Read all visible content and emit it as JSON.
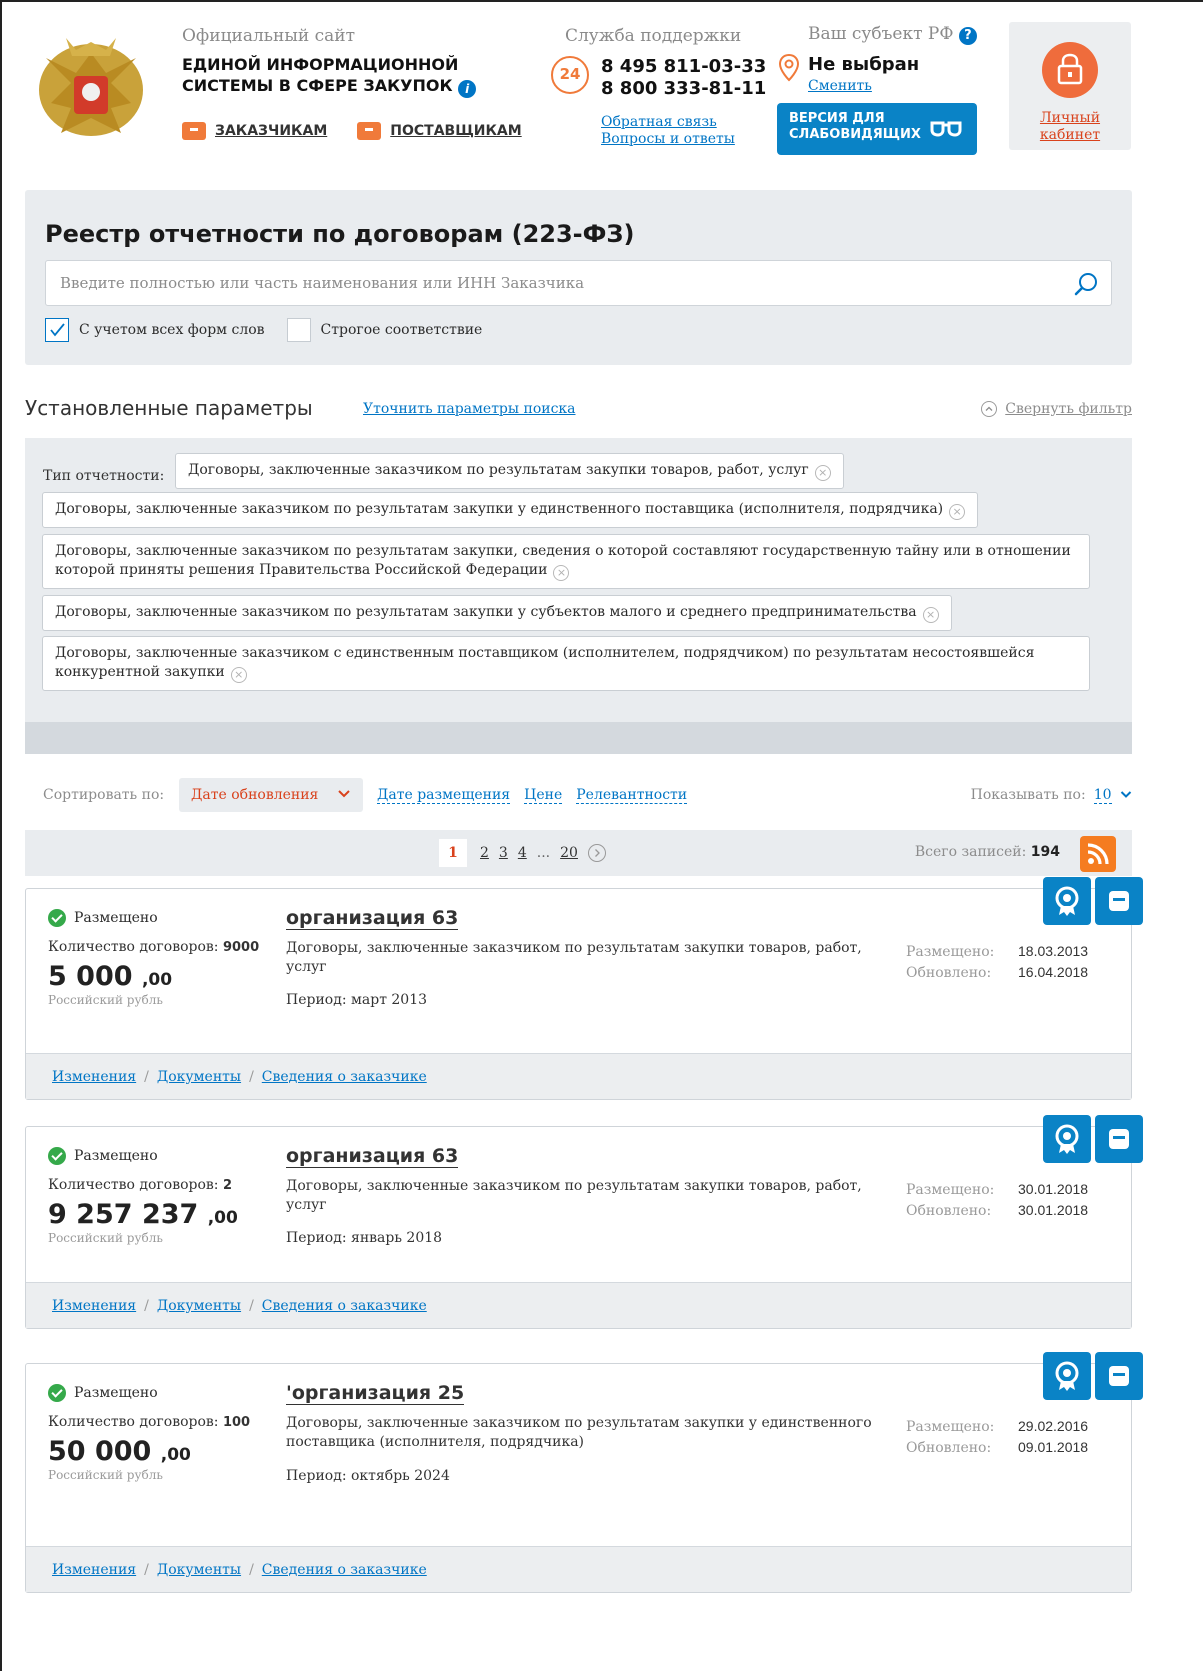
{
  "header": {
    "site_prefix": "Официальный сайт",
    "site_title": "ЕДИНОЙ ИНФОРМАЦИОННОЙ СИСТЕМЫ В СФЕРЕ ЗАКУПОК",
    "nav": {
      "customers": "ЗАКАЗЧИКАМ",
      "suppliers": "ПОСТАВЩИКАМ"
    },
    "support_title": "Службa поддержки",
    "support_badge": "24",
    "phone1": "8 495 811-03-33",
    "phone2": "8 800 333-81-11",
    "feedback": "Обратная связь",
    "faq": "Вопросы и ответы",
    "region_title": "Ваш субъект РФ",
    "region_value": "Не выбран",
    "region_change": "Сменить",
    "accessibility_line1": "ВЕРСИЯ ДЛЯ",
    "accessibility_line2": "СЛАБОВИДЯЩИХ",
    "cabinet_line1": "Личный",
    "cabinet_line2": "кабинет"
  },
  "search": {
    "title": "Реестр отчетности по договорам (223-ФЗ)",
    "placeholder": "Введите полностью или часть наименования или ИНН Заказчика",
    "morph_label": "С учетом всех форм слов",
    "morph_checked": true,
    "strict_label": "Строгое соответствие",
    "strict_checked": false
  },
  "params": {
    "title": "Установленные параметры",
    "refine": "Уточнить параметры поиска",
    "collapse": "Свернуть фильтр",
    "type_label": "Тип отчетности:",
    "tags": [
      "Договоры, заключенные заказчиком по результатам закупки товаров, работ, услуг",
      "Договоры, заключенные заказчиком по результатам закупки у единственного поставщика (исполнителя, подрядчика)",
      "Договоры, заключенные заказчиком по результатам закупки, сведения о которой составляют государственную тайну или в отношении которой приняты решения Правительства Российской Федерации",
      "Договоры, заключенные заказчиком по результатам закупки у субъектов малого и среднего предпринимательства",
      "Договоры, заключенные заказчиком с единственным поставщиком (исполнителем, подрядчиком) по результатам несостоявшейся конкурентной закупки"
    ]
  },
  "sort": {
    "label": "Сортировать по:",
    "active": "Дате обновления",
    "options": [
      "Дате размещения",
      "Цене",
      "Релевантности"
    ],
    "show_label": "Показывать по:",
    "show_value": "10"
  },
  "pager": {
    "current": "1",
    "pages": [
      "2",
      "3",
      "4"
    ],
    "ellipsis": "...",
    "last": "20",
    "total_label": "Всего записей:",
    "total": "194"
  },
  "cards": [
    {
      "status": "Размещено",
      "count_label": "Количество договоров:",
      "count": "9000",
      "price": "5 000",
      "kop": ",00",
      "currency": "Российский рубль",
      "org": "организация 63",
      "desc": "Договоры, заключенные заказчиком по результатам закупки товаров, работ, услуг",
      "period": "Период: март 2013",
      "posted_label": "Размещено:",
      "posted": "18.03.2013",
      "updated_label": "Обновлено:",
      "updated": "16.04.2018",
      "links": [
        "Изменения",
        "Документы",
        "Сведения о заказчике"
      ]
    },
    {
      "status": "Размещено",
      "count_label": "Количество договоров:",
      "count": "2",
      "price": "9 257 237",
      "kop": ",00",
      "currency": "Российский рубль",
      "org": "организация 63",
      "desc": "Договоры, заключенные заказчиком по результатам закупки товаров, работ, услуг",
      "period": "Период: январь 2018",
      "posted_label": "Размещено:",
      "posted": "30.01.2018",
      "updated_label": "Обновлено:",
      "updated": "30.01.2018",
      "links": [
        "Изменения",
        "Документы",
        "Сведения о заказчике"
      ]
    },
    {
      "status": "Размещено",
      "count_label": "Количество договоров:",
      "count": "100",
      "price": "50 000",
      "kop": ",00",
      "currency": "Российский рубль",
      "org": "'организация 25",
      "desc": "Договоры, заключенные заказчиком по результатам закупки у единственного поставщика (исполнителя, подрядчика)",
      "period": "Период: октябрь 2024",
      "posted_label": "Размещено:",
      "posted": "29.02.2016",
      "updated_label": "Обновлено:",
      "updated": "09.01.2018",
      "links": [
        "Изменения",
        "Документы",
        "Сведения о заказчике"
      ]
    }
  ],
  "colors": {
    "accent_blue": "#0a83c6",
    "accent_orange": "#ef6c3c",
    "status_green": "#35a94a",
    "panel_gray": "#e9ecef"
  }
}
